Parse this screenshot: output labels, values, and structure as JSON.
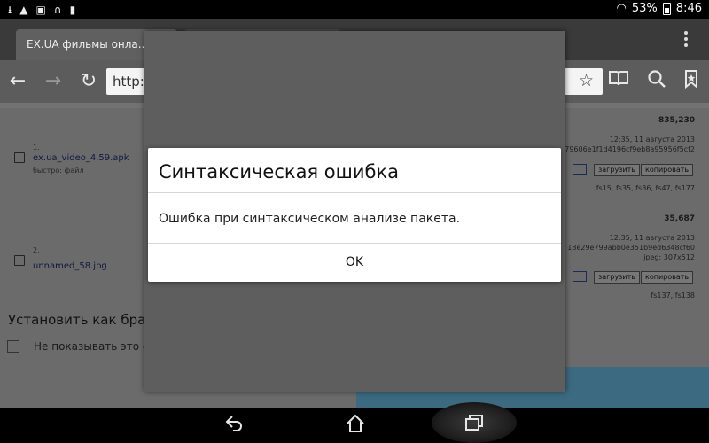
{
  "status_bar": {
    "battery": "53%",
    "time": "8:46"
  },
  "tabs": [
    {
      "title": "EX.UA фильмы онла..."
    },
    {
      "title": ""
    }
  ],
  "toolbar": {
    "url": "http:/"
  },
  "page": {
    "files": [
      {
        "number": "1.",
        "name": "ex.ua_video_4.59.apk",
        "subtitle": "быстро: файл",
        "size": "835,230",
        "date": "12:35, 11 августа 2013",
        "hash": "79606e1f1d4196cf9eb8a95956f5cf2",
        "upload_label": "загрузить",
        "copy_label": "копировать",
        "tags": "fs15, fs35, fs36, fs47, fs177"
      },
      {
        "number": "2.",
        "name": "unnamed_58.jpg",
        "subtitle": "",
        "size": "35,687",
        "date": "12:35, 11 августа 2013",
        "hash": "18e29e799abb0e351b9ed6348cf60",
        "meta": "jpeg: 307x512",
        "upload_label": "загрузить",
        "copy_label": "копировать",
        "tags": "fs137, fs138"
      }
    ],
    "browser_prompt": "Установить как брауз",
    "dont_show_label": "Не показывать это соо"
  },
  "dialog": {
    "title": "Синтаксическая ошибка",
    "message": "Ошибка при синтаксическом анализе пакета.",
    "ok_label": "OK"
  },
  "colors": {
    "dialog_bg": "#ffffff",
    "scrim": "#6b6b6b",
    "accent_bar": "#3c6a80"
  }
}
